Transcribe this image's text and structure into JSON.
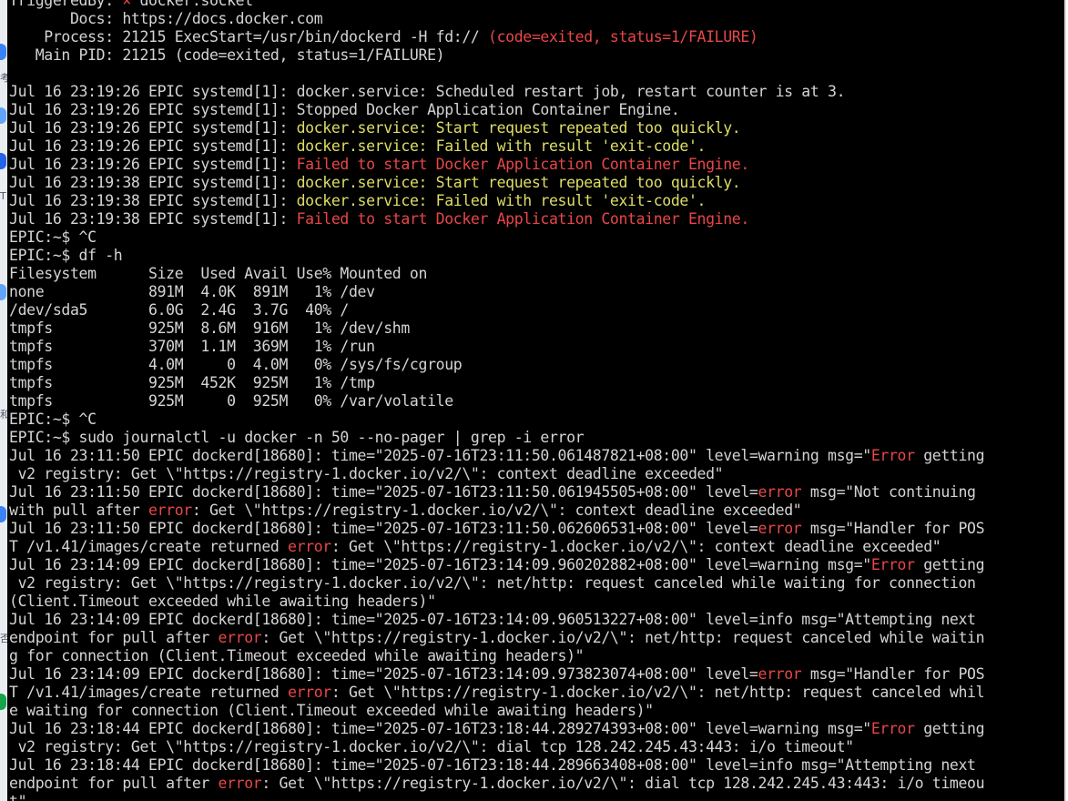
{
  "colors": {
    "background": "#000000",
    "foreground": "#d4d4d4",
    "red": "#e84747",
    "yellow": "#dede66",
    "side_strip": "#e9edf2"
  },
  "side_strip": {
    "glyphs": [
      "考",
      "T",
      "和",
      "否"
    ]
  },
  "terminal": {
    "lines": [
      [
        {
          "t": "TriggeredBy: ",
          "c": "normal"
        },
        {
          "t": "× ",
          "c": "red"
        },
        {
          "t": "docker.socket",
          "c": "normal"
        }
      ],
      [
        {
          "t": "       Docs: https://docs.docker.com",
          "c": "normal"
        }
      ],
      [
        {
          "t": "    Process: 21215 ExecStart=/usr/bin/dockerd -H fd:// ",
          "c": "normal"
        },
        {
          "t": "(code=exited, status=1/FAILURE)",
          "c": "red"
        }
      ],
      [
        {
          "t": "   Main PID: 21215 (code=exited, status=1/FAILURE)",
          "c": "normal"
        }
      ],
      [
        {
          "t": "",
          "c": "normal"
        }
      ],
      [
        {
          "t": "Jul 16 23:19:26 EPIC systemd[1]: docker.service: Scheduled restart job, restart counter is at 3.",
          "c": "normal"
        }
      ],
      [
        {
          "t": "Jul 16 23:19:26 EPIC systemd[1]: Stopped Docker Application Container Engine.",
          "c": "normal"
        }
      ],
      [
        {
          "t": "Jul 16 23:19:26 EPIC systemd[1]: ",
          "c": "normal"
        },
        {
          "t": "docker.service: Start request repeated too quickly.",
          "c": "yellow"
        }
      ],
      [
        {
          "t": "Jul 16 23:19:26 EPIC systemd[1]: ",
          "c": "normal"
        },
        {
          "t": "docker.service: Failed with result 'exit-code'.",
          "c": "yellow"
        }
      ],
      [
        {
          "t": "Jul 16 23:19:26 EPIC systemd[1]: ",
          "c": "normal"
        },
        {
          "t": "Failed to start Docker Application Container Engine.",
          "c": "red"
        }
      ],
      [
        {
          "t": "Jul 16 23:19:38 EPIC systemd[1]: ",
          "c": "normal"
        },
        {
          "t": "docker.service: Start request repeated too quickly.",
          "c": "yellow"
        }
      ],
      [
        {
          "t": "Jul 16 23:19:38 EPIC systemd[1]: ",
          "c": "normal"
        },
        {
          "t": "docker.service: Failed with result 'exit-code'.",
          "c": "yellow"
        }
      ],
      [
        {
          "t": "Jul 16 23:19:38 EPIC systemd[1]: ",
          "c": "normal"
        },
        {
          "t": "Failed to start Docker Application Container Engine.",
          "c": "red"
        }
      ],
      [
        {
          "t": "EPIC:~$ ^C",
          "c": "normal"
        }
      ],
      [
        {
          "t": "EPIC:~$ df -h",
          "c": "normal"
        }
      ],
      [
        {
          "t": "Filesystem      Size  Used Avail Use% Mounted on",
          "c": "normal"
        }
      ],
      [
        {
          "t": "none            891M  4.0K  891M   1% /dev",
          "c": "normal"
        }
      ],
      [
        {
          "t": "/dev/sda5       6.0G  2.4G  3.7G  40% /",
          "c": "normal"
        }
      ],
      [
        {
          "t": "tmpfs           925M  8.6M  916M   1% /dev/shm",
          "c": "normal"
        }
      ],
      [
        {
          "t": "tmpfs           370M  1.1M  369M   1% /run",
          "c": "normal"
        }
      ],
      [
        {
          "t": "tmpfs           4.0M     0  4.0M   0% /sys/fs/cgroup",
          "c": "normal"
        }
      ],
      [
        {
          "t": "tmpfs           925M  452K  925M   1% /tmp",
          "c": "normal"
        }
      ],
      [
        {
          "t": "tmpfs           925M     0  925M   0% /var/volatile",
          "c": "normal"
        }
      ],
      [
        {
          "t": "EPIC:~$ ^C",
          "c": "normal"
        }
      ],
      [
        {
          "t": "EPIC:~$ sudo journalctl -u docker -n 50 --no-pager | grep -i error",
          "c": "normal"
        }
      ],
      [
        {
          "t": "Jul 16 23:11:50 EPIC dockerd[18680]: time=\"2025-07-16T23:11:50.061487821+08:00\" level=warning msg=\"",
          "c": "normal"
        },
        {
          "t": "Error",
          "c": "red"
        },
        {
          "t": " getting",
          "c": "normal"
        }
      ],
      [
        {
          "t": " v2 registry: Get \\\"https://registry-1.docker.io/v2/\\\": context deadline exceeded\"",
          "c": "normal"
        }
      ],
      [
        {
          "t": "Jul 16 23:11:50 EPIC dockerd[18680]: time=\"2025-07-16T23:11:50.061945505+08:00\" level=",
          "c": "normal"
        },
        {
          "t": "error",
          "c": "red"
        },
        {
          "t": " msg=\"Not continuing",
          "c": "normal"
        }
      ],
      [
        {
          "t": "with pull after ",
          "c": "normal"
        },
        {
          "t": "error",
          "c": "red"
        },
        {
          "t": ": Get \\\"https://registry-1.docker.io/v2/\\\": context deadline exceeded\"",
          "c": "normal"
        }
      ],
      [
        {
          "t": "Jul 16 23:11:50 EPIC dockerd[18680]: time=\"2025-07-16T23:11:50.062606531+08:00\" level=",
          "c": "normal"
        },
        {
          "t": "error",
          "c": "red"
        },
        {
          "t": " msg=\"Handler for POS",
          "c": "normal"
        }
      ],
      [
        {
          "t": "T /v1.41/images/create returned ",
          "c": "normal"
        },
        {
          "t": "error",
          "c": "red"
        },
        {
          "t": ": Get \\\"https://registry-1.docker.io/v2/\\\": context deadline exceeded\"",
          "c": "normal"
        }
      ],
      [
        {
          "t": "Jul 16 23:14:09 EPIC dockerd[18680]: time=\"2025-07-16T23:14:09.960202882+08:00\" level=warning msg=\"",
          "c": "normal"
        },
        {
          "t": "Error",
          "c": "red"
        },
        {
          "t": " getting",
          "c": "normal"
        }
      ],
      [
        {
          "t": " v2 registry: Get \\\"https://registry-1.docker.io/v2/\\\": net/http: request canceled while waiting for connection",
          "c": "normal"
        }
      ],
      [
        {
          "t": "(Client.Timeout exceeded while awaiting headers)\"",
          "c": "normal"
        }
      ],
      [
        {
          "t": "Jul 16 23:14:09 EPIC dockerd[18680]: time=\"2025-07-16T23:14:09.960513227+08:00\" level=info msg=\"Attempting next",
          "c": "normal"
        }
      ],
      [
        {
          "t": "endpoint for pull after ",
          "c": "normal"
        },
        {
          "t": "error",
          "c": "red"
        },
        {
          "t": ": Get \\\"https://registry-1.docker.io/v2/\\\": net/http: request canceled while waitin",
          "c": "normal"
        }
      ],
      [
        {
          "t": "g for connection (Client.Timeout exceeded while awaiting headers)\"",
          "c": "normal"
        }
      ],
      [
        {
          "t": "Jul 16 23:14:09 EPIC dockerd[18680]: time=\"2025-07-16T23:14:09.973823074+08:00\" level=",
          "c": "normal"
        },
        {
          "t": "error",
          "c": "red"
        },
        {
          "t": " msg=\"Handler for POS",
          "c": "normal"
        }
      ],
      [
        {
          "t": "T /v1.41/images/create returned ",
          "c": "normal"
        },
        {
          "t": "error",
          "c": "red"
        },
        {
          "t": ": Get \\\"https://registry-1.docker.io/v2/\\\": net/http: request canceled whil",
          "c": "normal"
        }
      ],
      [
        {
          "t": "e waiting for connection (Client.Timeout exceeded while awaiting headers)\"",
          "c": "normal"
        }
      ],
      [
        {
          "t": "Jul 16 23:18:44 EPIC dockerd[18680]: time=\"2025-07-16T23:18:44.289274393+08:00\" level=warning msg=\"",
          "c": "normal"
        },
        {
          "t": "Error",
          "c": "red"
        },
        {
          "t": " getting",
          "c": "normal"
        }
      ],
      [
        {
          "t": " v2 registry: Get \\\"https://registry-1.docker.io/v2/\\\": dial tcp 128.242.245.43:443: i/o timeout\"",
          "c": "normal"
        }
      ],
      [
        {
          "t": "Jul 16 23:18:44 EPIC dockerd[18680]: time=\"2025-07-16T23:18:44.289663408+08:00\" level=info msg=\"Attempting next",
          "c": "normal"
        }
      ],
      [
        {
          "t": "endpoint for pull after ",
          "c": "normal"
        },
        {
          "t": "error",
          "c": "red"
        },
        {
          "t": ": Get \\\"https://registry-1.docker.io/v2/\\\": dial tcp 128.242.245.43:443: i/o timeou",
          "c": "normal"
        }
      ],
      [
        {
          "t": "t\"",
          "c": "normal"
        }
      ]
    ]
  }
}
